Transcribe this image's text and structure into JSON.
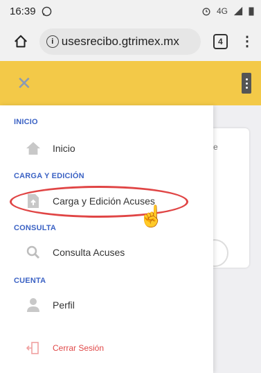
{
  "status": {
    "time": "16:39",
    "network": "4G"
  },
  "browser": {
    "url": "usesrecibo.gtrimex.mx",
    "tab_count": "4"
  },
  "app": {
    "header_color": "#f3c948",
    "background_text": "e"
  },
  "drawer": {
    "sections": [
      {
        "title": "INICIO",
        "items": [
          {
            "label": "Inicio",
            "icon": "home-icon"
          }
        ]
      },
      {
        "title": "CARGA Y EDICIÓN",
        "items": [
          {
            "label": "Carga y Edición Acuses",
            "icon": "file-upload-icon"
          }
        ]
      },
      {
        "title": "CONSULTA",
        "items": [
          {
            "label": "Consulta Acuses",
            "icon": "search-icon"
          }
        ]
      },
      {
        "title": "CUENTA",
        "items": [
          {
            "label": "Perfil",
            "icon": "user-icon"
          }
        ]
      }
    ],
    "logout_label": "Cerrar Sesión",
    "accent_color": "#3b62c4",
    "logout_color": "#e04848"
  },
  "annotation": {
    "highlight_color": "#e04545"
  }
}
